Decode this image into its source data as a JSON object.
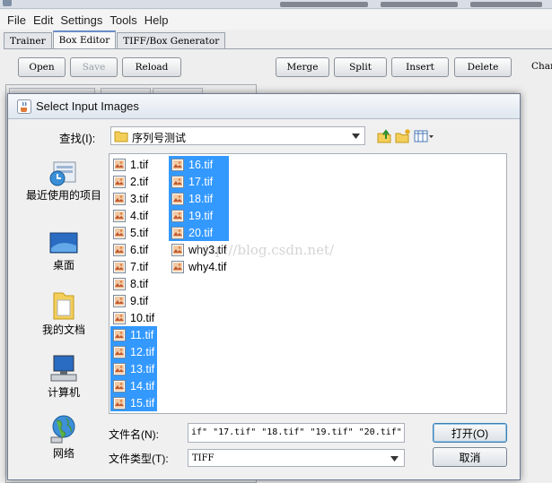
{
  "app": {
    "title": "",
    "menu": [
      "File",
      "Edit",
      "Settings",
      "Tools",
      "Help"
    ],
    "tabs": [
      {
        "label": "Trainer",
        "active": false
      },
      {
        "label": "Box Editor",
        "active": true
      },
      {
        "label": "TIFF/Box Generator",
        "active": false
      }
    ],
    "toolbar": {
      "open": "Open",
      "save": "Save",
      "reload": "Reload",
      "merge": "Merge",
      "split": "Split",
      "insert": "Insert",
      "delete": "Delete",
      "clipped": "Char"
    }
  },
  "dialog": {
    "title": "Select Input Images",
    "look_in_label": "查找(I):",
    "look_in_value": "序列号测试",
    "places": [
      {
        "label": "最近使用的项目",
        "icon": "recent-items-icon"
      },
      {
        "label": "桌面",
        "icon": "desktop-icon"
      },
      {
        "label": "我的文档",
        "icon": "documents-icon"
      },
      {
        "label": "计算机",
        "icon": "computer-icon"
      },
      {
        "label": "网络",
        "icon": "network-icon"
      }
    ],
    "files_col1": [
      {
        "name": "1.tif",
        "selected": false
      },
      {
        "name": "2.tif",
        "selected": false
      },
      {
        "name": "3.tif",
        "selected": false
      },
      {
        "name": "4.tif",
        "selected": false
      },
      {
        "name": "5.tif",
        "selected": false
      },
      {
        "name": "6.tif",
        "selected": false
      },
      {
        "name": "7.tif",
        "selected": false
      },
      {
        "name": "8.tif",
        "selected": false
      },
      {
        "name": "9.tif",
        "selected": false
      },
      {
        "name": "10.tif",
        "selected": false
      },
      {
        "name": "11.tif",
        "selected": true
      },
      {
        "name": "12.tif",
        "selected": true
      },
      {
        "name": "13.tif",
        "selected": true
      },
      {
        "name": "14.tif",
        "selected": true
      },
      {
        "name": "15.tif",
        "selected": true
      }
    ],
    "files_col2": [
      {
        "name": "16.tif",
        "selected": true
      },
      {
        "name": "17.tif",
        "selected": true
      },
      {
        "name": "18.tif",
        "selected": true
      },
      {
        "name": "19.tif",
        "selected": true
      },
      {
        "name": "20.tif",
        "selected": true
      },
      {
        "name": "why3.tif",
        "selected": false
      },
      {
        "name": "why4.tif",
        "selected": false
      }
    ],
    "file_name_label": "文件名(N):",
    "file_name_value": "if\" \"17.tif\" \"18.tif\" \"19.tif\" \"20.tif\"",
    "file_type_label": "文件类型(T):",
    "file_type_value": "TIFF",
    "open_button": "打开(O)",
    "cancel_button": "取消"
  },
  "watermark": "http://blog.csdn.net/",
  "colors": {
    "selection": "#3399ff",
    "dialog_bg": "#f0f0f0",
    "app_bg": "#eeeeee"
  }
}
